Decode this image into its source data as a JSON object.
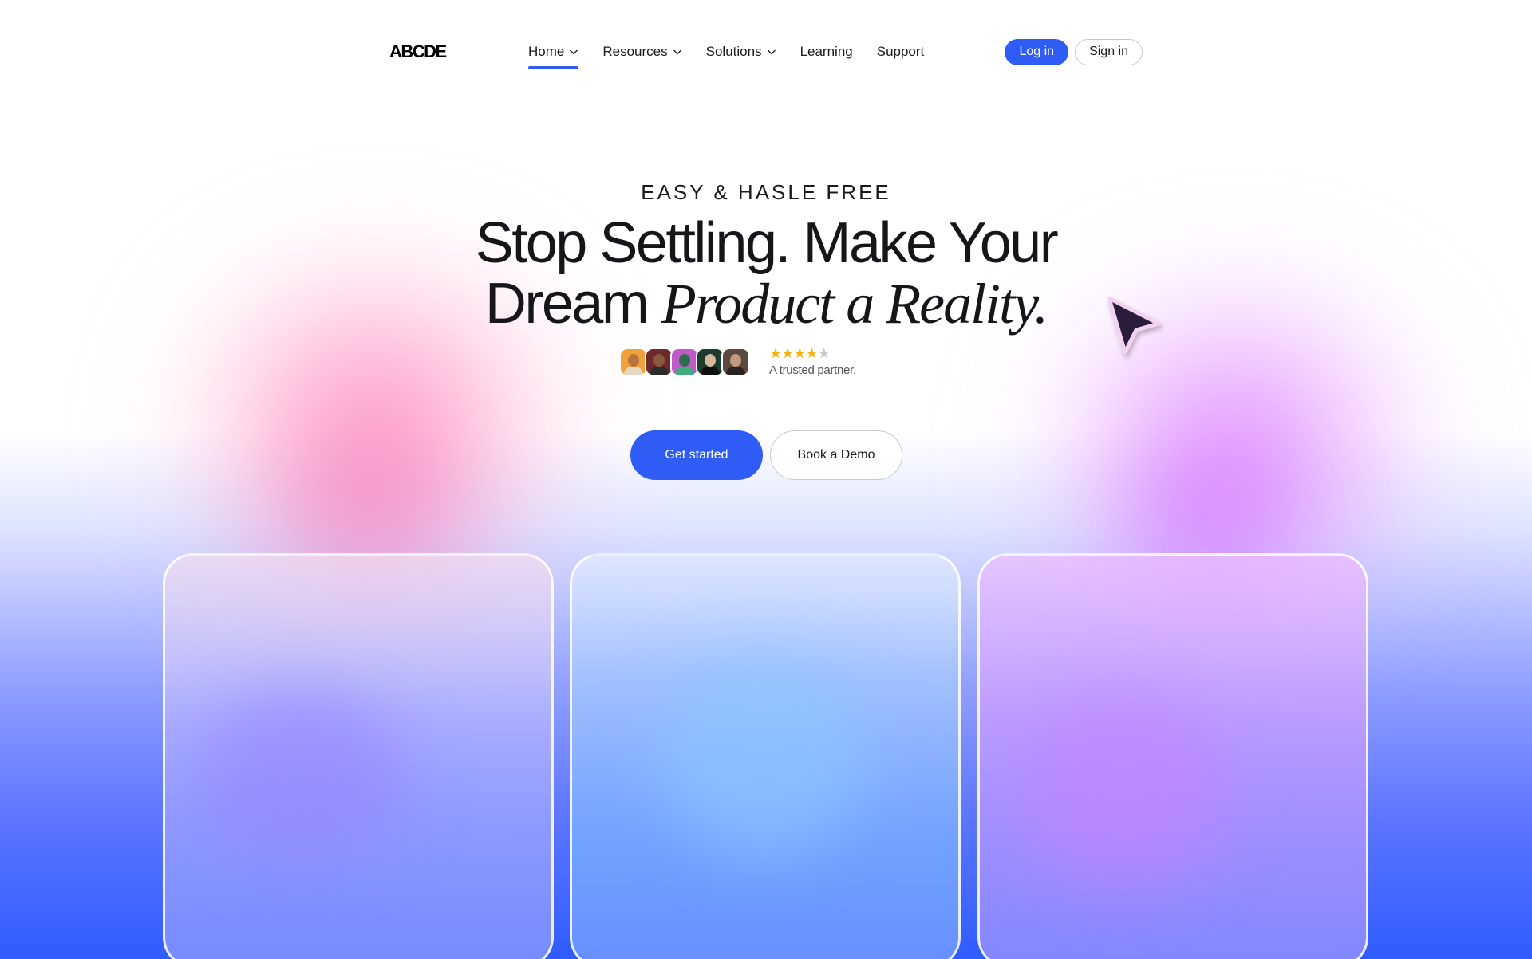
{
  "brand": {
    "logo": "ABCDE"
  },
  "nav": {
    "items": [
      {
        "label": "Home",
        "dropdown": true,
        "active": true
      },
      {
        "label": "Resources",
        "dropdown": true
      },
      {
        "label": "Solutions",
        "dropdown": true
      },
      {
        "label": "Learning",
        "dropdown": false
      },
      {
        "label": "Support",
        "dropdown": false
      }
    ],
    "login_label": "Log in",
    "signin_label": "Sign in"
  },
  "hero": {
    "eyebrow": "EASY & HASLE FREE",
    "headline_line1": "Stop Settling. Make Your",
    "headline_line2_plain": "Dream",
    "headline_line2_italic": "Product a Reality.",
    "rating": {
      "stars": 4.5,
      "out_of": 5,
      "text": "A trusted partner."
    },
    "avatars": 5,
    "primary_cta": "Get started",
    "secondary_cta": "Book a Demo"
  },
  "colors": {
    "accent": "#2f5cf5",
    "star": "#f5b400",
    "cursor": "#2b1d3a"
  }
}
